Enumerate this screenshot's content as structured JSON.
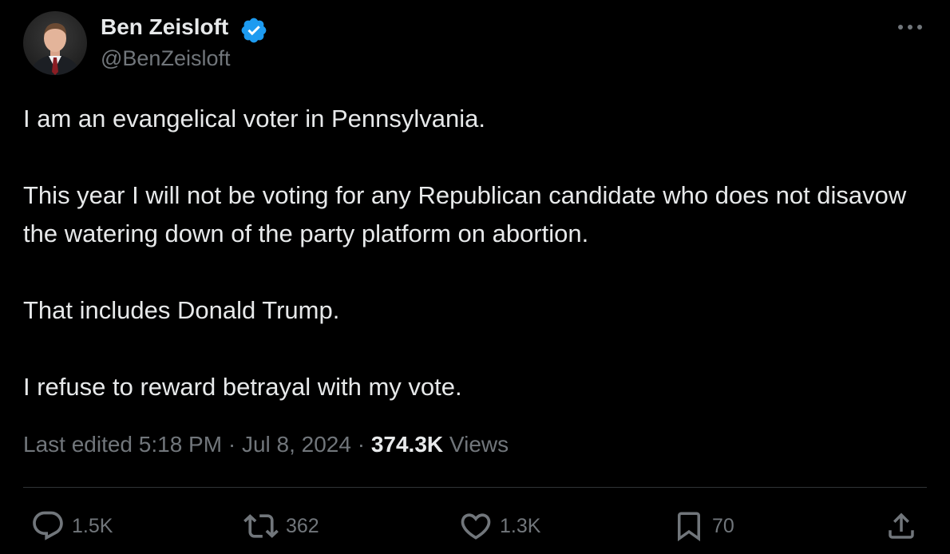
{
  "author": {
    "name": "Ben Zeisloft",
    "handle": "@BenZeisloft",
    "verified": true
  },
  "tweet": {
    "paragraphs": [
      "I am an evangelical voter in Pennsylvania.",
      "This year I will not be voting for any Republican candidate who does not disavow the watering down of the party platform on abortion.",
      "That includes Donald Trump.",
      "I refuse to reward betrayal with my vote."
    ]
  },
  "meta": {
    "edited_label": "Last edited",
    "time": "5:18 PM",
    "separator": "·",
    "date": "Jul 8, 2024",
    "views_count": "374.3K",
    "views_label": "Views"
  },
  "actions": {
    "replies": "1.5K",
    "reposts": "362",
    "likes": "1.3K",
    "bookmarks": "70"
  },
  "icons": {
    "verified": "verified-badge-icon",
    "more": "more-horizontal-icon",
    "reply": "reply-icon",
    "repost": "repost-icon",
    "like": "heart-icon",
    "bookmark": "bookmark-icon",
    "share": "share-icon"
  },
  "colors": {
    "background": "#000000",
    "text_primary": "#e7e9ea",
    "text_secondary": "#71767b",
    "verified_blue": "#1d9bf0",
    "divider": "#2f3336"
  }
}
